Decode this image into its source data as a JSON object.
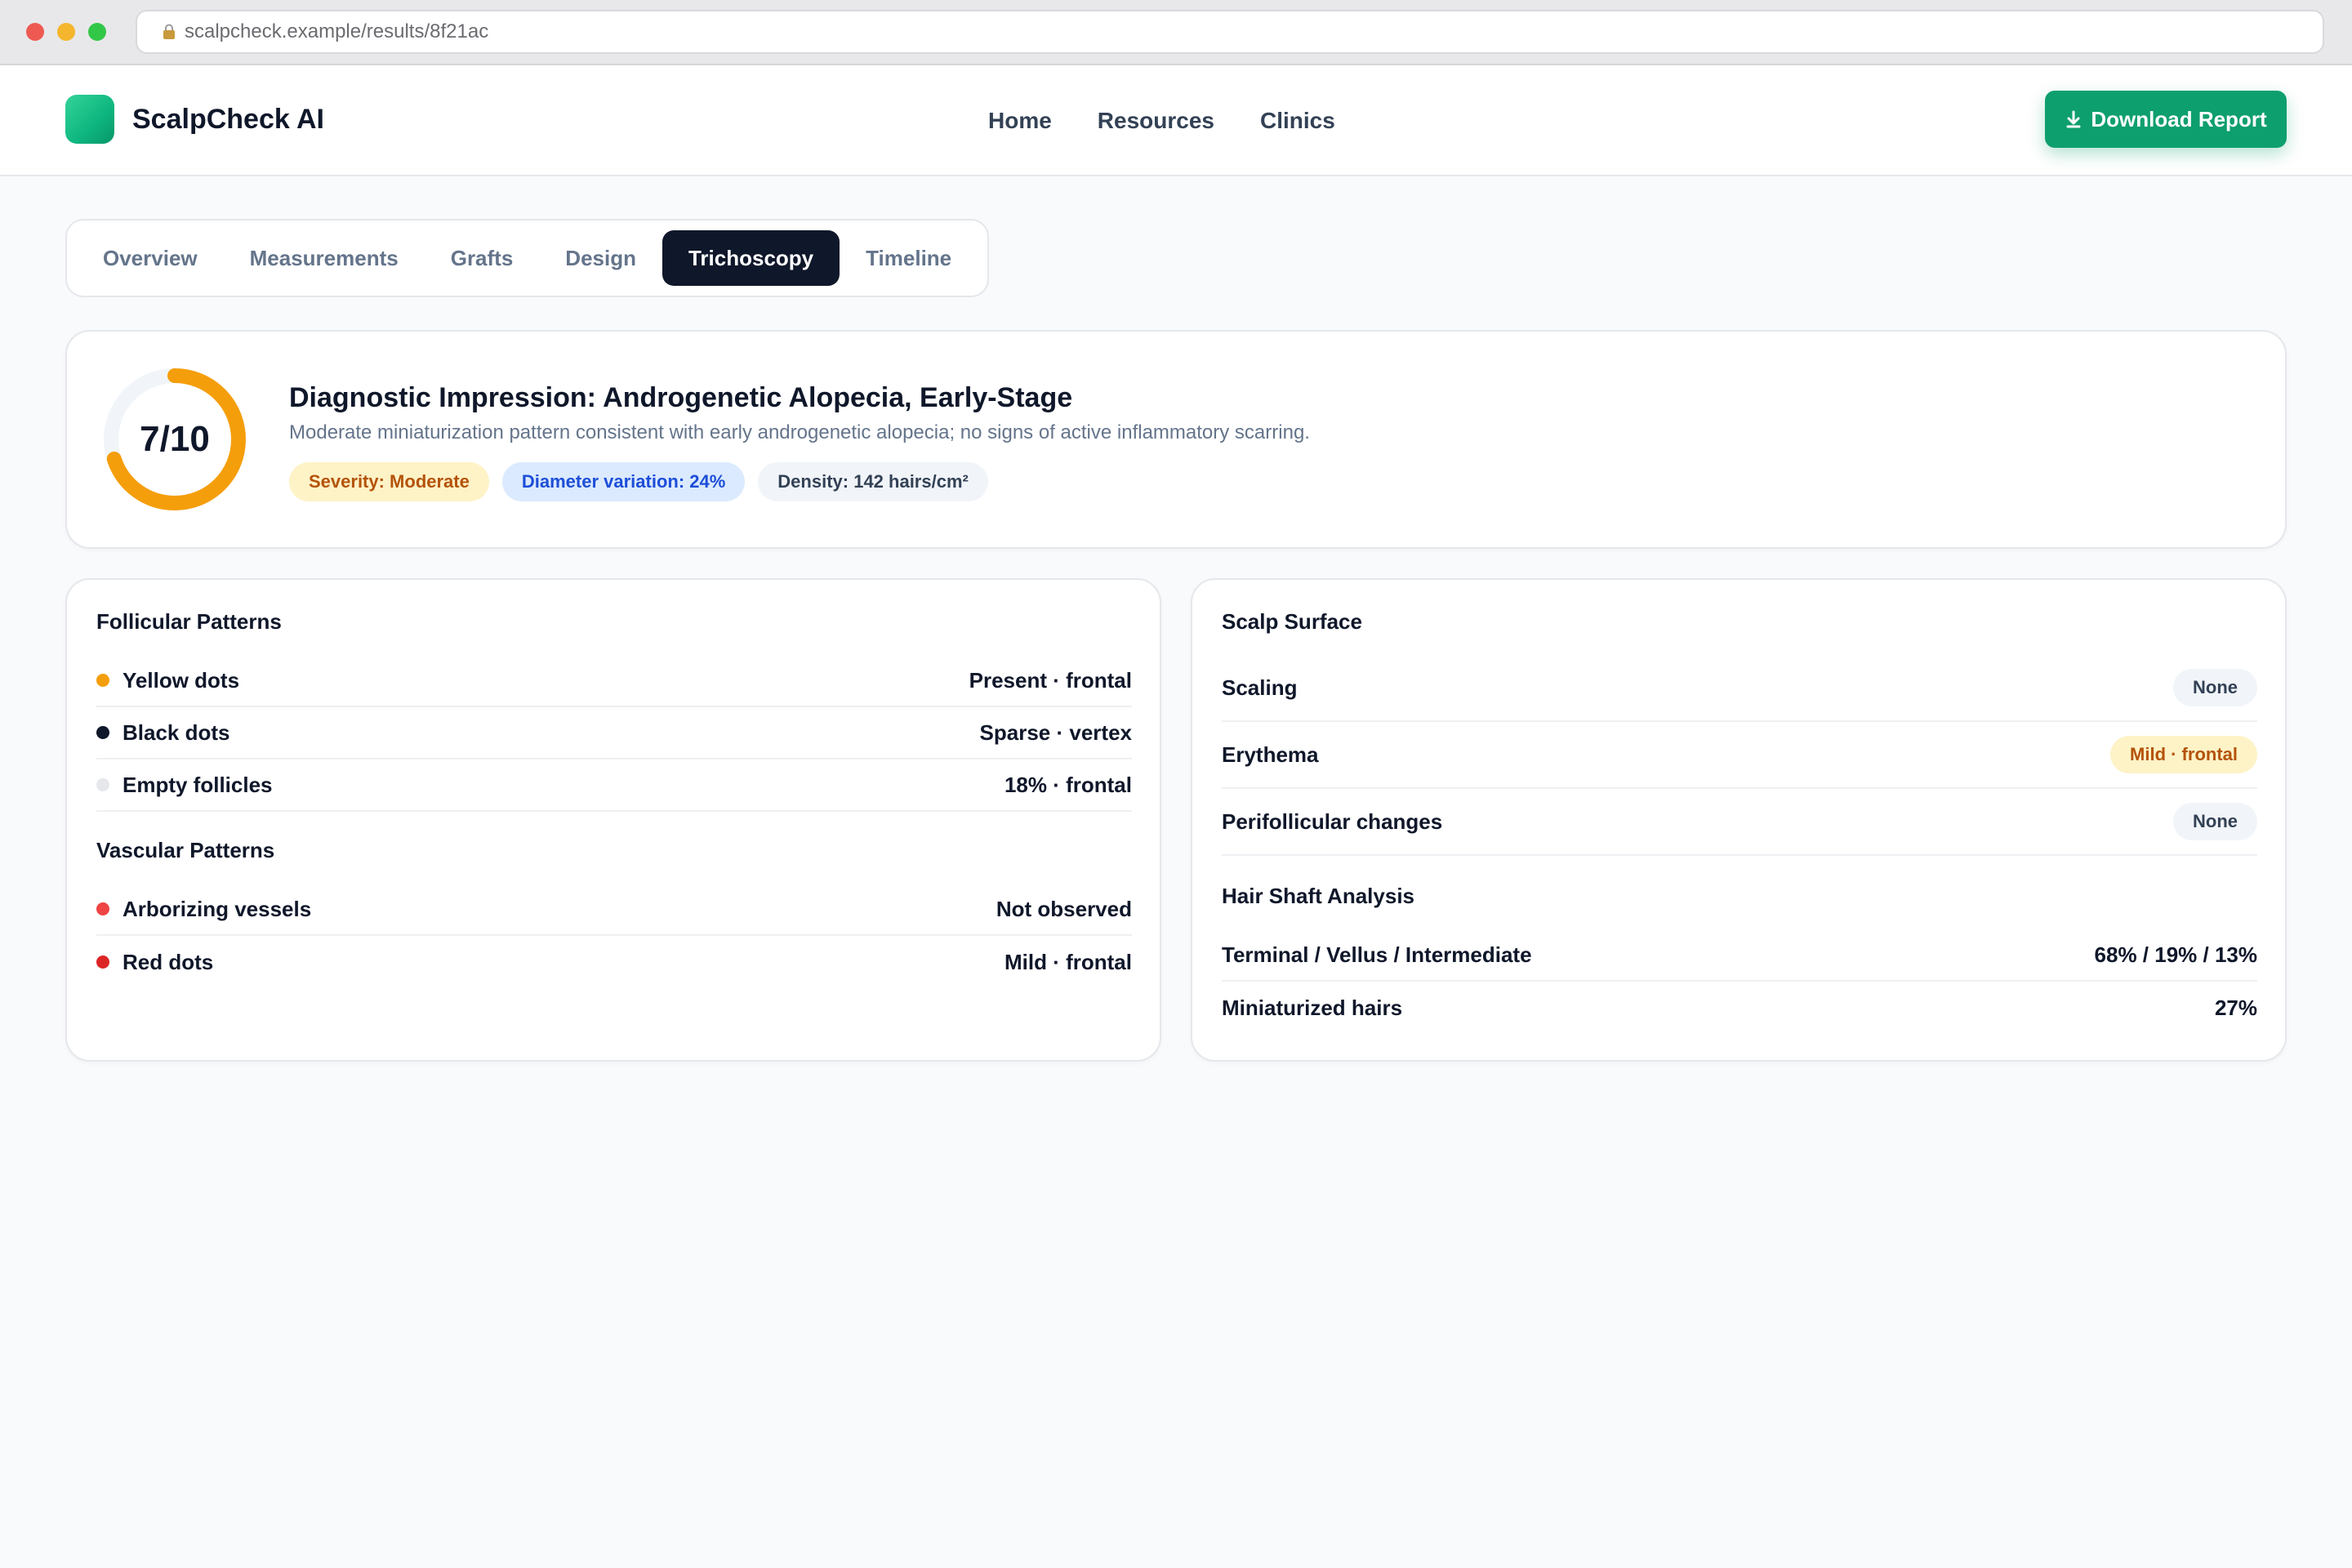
{
  "browser": {
    "url": "scalpcheck.example/results/8f21ac"
  },
  "header": {
    "brand_name": "ScalpCheck AI",
    "nav": [
      "Home",
      "Resources",
      "Clinics"
    ],
    "download_label": "Download Report",
    "accent_color": "#0e9f6e"
  },
  "tabs": [
    {
      "label": "Overview",
      "active": false
    },
    {
      "label": "Measurements",
      "active": false
    },
    {
      "label": "Grafts",
      "active": false
    },
    {
      "label": "Design",
      "active": false
    },
    {
      "label": "Trichoscopy",
      "active": true
    },
    {
      "label": "Timeline",
      "active": false
    }
  ],
  "diagnosis": {
    "score_label": "7/10",
    "score_fraction": 0.7,
    "score_color": "#f59e0b",
    "title": "Diagnostic Impression: Androgenetic Alopecia, Early-Stage",
    "description": "Moderate miniaturization pattern consistent with early androgenetic alopecia; no signs of active inflammatory scarring.",
    "badges": [
      {
        "text": "Severity: Moderate",
        "style": "amber"
      },
      {
        "text": "Diameter variation: 24%",
        "style": "blue"
      },
      {
        "text": "Density: 142 hairs/cm²",
        "style": "grey"
      }
    ]
  },
  "follicular": {
    "title": "Follicular Patterns",
    "items": [
      {
        "label": "Yellow dots",
        "value": "Present · frontal",
        "dot_color": "#f59e0b"
      },
      {
        "label": "Black dots",
        "value": "Sparse · vertex",
        "dot_color": "#0f172a"
      },
      {
        "label": "Empty follicles",
        "value": "18% · frontal",
        "dot_color": "#e5e7eb"
      }
    ]
  },
  "vascular": {
    "title": "Vascular Patterns",
    "items": [
      {
        "label": "Arborizing vessels",
        "value": "Not observed",
        "dot_color": "#ef4444"
      },
      {
        "label": "Red dots",
        "value": "Mild · frontal",
        "dot_color": "#dc2626"
      }
    ]
  },
  "scalp_surface": {
    "title": "Scalp Surface",
    "items": [
      {
        "label": "Scaling",
        "value": "None",
        "style": "grey"
      },
      {
        "label": "Erythema",
        "value": "Mild · frontal",
        "style": "amber"
      },
      {
        "label": "Perifollicular changes",
        "value": "None",
        "style": "grey"
      }
    ]
  },
  "hair_shaft": {
    "title": "Hair Shaft Analysis",
    "items": [
      {
        "label": "Terminal / Vellus / Intermediate",
        "value": "68% / 19% / 13%"
      },
      {
        "label": "Miniaturized hairs",
        "value": "27%"
      }
    ]
  }
}
